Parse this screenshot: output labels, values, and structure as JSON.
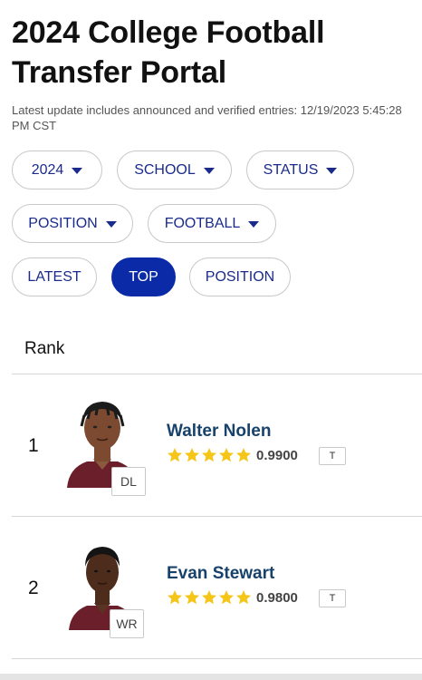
{
  "title": "2024 College Football Transfer Portal",
  "update_text": "Latest update includes announced and verified entries: 12/19/2023 5:45:28 PM CST",
  "filters": {
    "year": "2024",
    "school": "SCHOOL",
    "status": "STATUS",
    "position": "POSITION",
    "sport": "FOOTBALL"
  },
  "sort_tabs": {
    "latest": "LATEST",
    "top": "TOP",
    "position": "POSITION",
    "active": "TOP"
  },
  "rank_header": "Rank",
  "players": [
    {
      "rank": "1",
      "name": "Walter Nolen",
      "position": "DL",
      "rating": "0.9900",
      "stars": 5,
      "tag": "T"
    },
    {
      "rank": "2",
      "name": "Evan Stewart",
      "position": "WR",
      "rating": "0.9800",
      "stars": 5,
      "tag": "T"
    }
  ],
  "colors": {
    "accent": "#0b2aa8",
    "player_name": "#17426b",
    "star": "#f5c518",
    "jersey": "#6b1f2a"
  }
}
